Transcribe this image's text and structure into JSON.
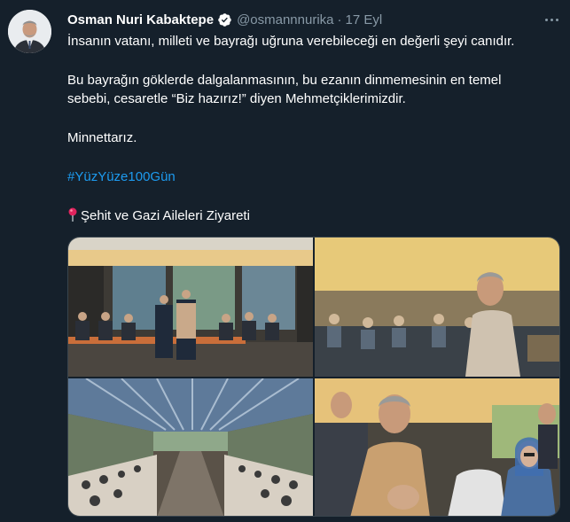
{
  "author": {
    "name": "Osman Nuri Kabaktepe",
    "handle": "@osmannnurika",
    "separator": "·",
    "time": "17 Eyl",
    "verified": true
  },
  "tweet": {
    "line1": "İnsanın vatanı, milleti ve bayrağı uğruna verebileceği en değerli şeyi canıdır.",
    "line2": "Bu bayrağın göklerde dalgalanmasının, bu ezanın dinmemesinin en temel",
    "line3": "sebebi, cesaretle “Biz hazırız!” diyen Mehmetçiklerimizdir.",
    "line4": "Minnettarız.",
    "hashtag": "#YüzYüze100Gün",
    "location_line": "Şehit ve Gazi Aileleri Ziyareti",
    "location_icon": "round-pushpin-icon"
  },
  "media": {
    "photos": [
      {
        "name": "photo-meeting-table"
      },
      {
        "name": "photo-speaker-with-guests"
      },
      {
        "name": "photo-restaurant-hall"
      },
      {
        "name": "photo-greeting-guests"
      }
    ]
  },
  "colors": {
    "background": "#15202b",
    "text": "#ffffff",
    "muted": "#8899a6",
    "link": "#1d9bf0",
    "verified": "#ffffff"
  },
  "icons": {
    "more": "more-horizontal-icon",
    "verified": "verified-badge-icon"
  }
}
